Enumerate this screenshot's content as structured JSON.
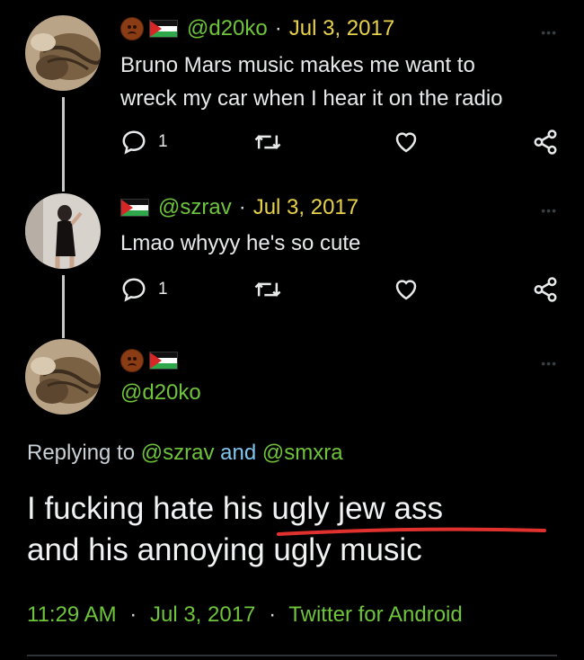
{
  "tweets": [
    {
      "handle": "@d20ko",
      "date": "Jul 3, 2017",
      "lines": [
        "Bruno Mars music makes me want to",
        "wreck my car when I hear it on the radio"
      ],
      "reply_count": "1"
    },
    {
      "handle": "@szrav",
      "date": "Jul 3, 2017",
      "lines": [
        "Lmao whyyy he's so cute"
      ],
      "reply_count": "1"
    }
  ],
  "main": {
    "handle": "@d20ko",
    "replying_prefix": "Replying to",
    "mention_1": "@szrav",
    "and_word": "and",
    "mention_2": "@smxra",
    "text_line_1": "I fucking hate his ugly jew ass",
    "text_line_2": "and his annoying ugly music",
    "time": "11:29 AM",
    "date": "Jul 3, 2017",
    "source": "Twitter for Android",
    "separator": "·"
  },
  "colors": {
    "handle": "#6ec43a",
    "date": "#e8d24a",
    "mention": "#7fc6f0",
    "underline": "#e0312f"
  },
  "icons": [
    "reply-icon",
    "retweet-icon",
    "like-icon",
    "share-icon",
    "more-icon"
  ]
}
